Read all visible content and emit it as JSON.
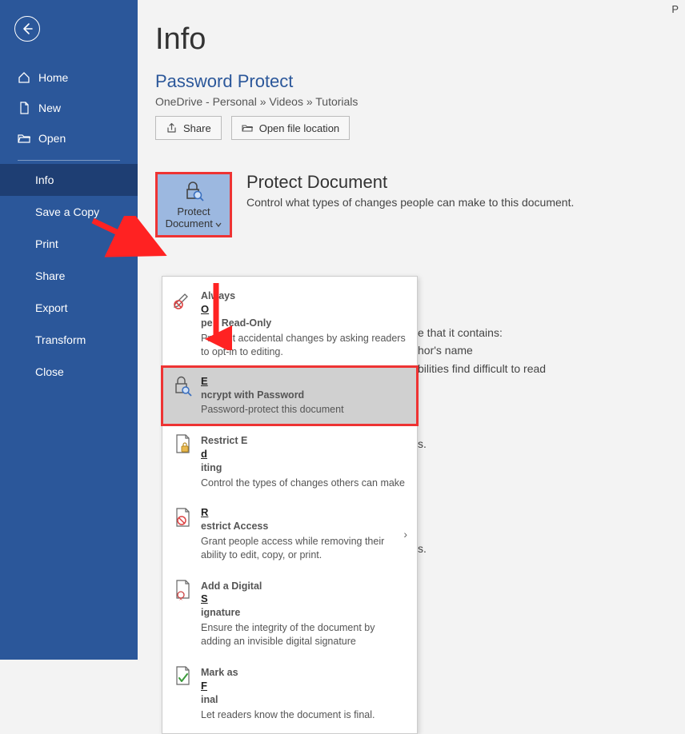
{
  "topRightLetter": "P",
  "sidebar": {
    "items": [
      {
        "label": "Home"
      },
      {
        "label": "New"
      },
      {
        "label": "Open"
      }
    ],
    "subs": [
      {
        "label": "Info",
        "active": true
      },
      {
        "label": "Save a Copy"
      },
      {
        "label": "Print"
      },
      {
        "label": "Share"
      },
      {
        "label": "Export"
      },
      {
        "label": "Transform"
      },
      {
        "label": "Close"
      }
    ]
  },
  "main": {
    "title": "Info",
    "subtitle": "Password Protect",
    "breadcrumb": "OneDrive - Personal » Videos » Tutorials",
    "shareBtn": "Share",
    "openLocationBtn": "Open file location",
    "protectHeading": "Protect Document",
    "protectDesc": "Control what types of changes people can make to this document.",
    "protectBtnLabel1": "Protect",
    "protectBtnLabel2": "Document"
  },
  "dropdown": {
    "items": [
      {
        "title": "Always Open Read-Only",
        "underline": "O",
        "desc": "Prevent accidental changes by asking readers to opt-in to editing."
      },
      {
        "title": "Encrypt with Password",
        "underline": "E",
        "desc": "Password-protect this document"
      },
      {
        "title": "Restrict Editing",
        "underline": "D",
        "desc": "Control the types of changes others can make"
      },
      {
        "title": "Restrict Access",
        "underline": "R",
        "desc": "Grant people access while removing their ability to edit, copy, or print.",
        "hasSub": true
      },
      {
        "title": "Add a Digital Signature",
        "underline": "S",
        "desc": "Ensure the integrity of the document by adding an invisible digital signature"
      },
      {
        "title": "Mark as Final",
        "underline": "F",
        "desc": "Let readers know the document is final."
      }
    ]
  },
  "bgText": {
    "line1": "e that it contains:",
    "line2": "hor's name",
    "line3": "bilities find difficult to read",
    "lineS1": "s.",
    "lineS2": "s."
  }
}
